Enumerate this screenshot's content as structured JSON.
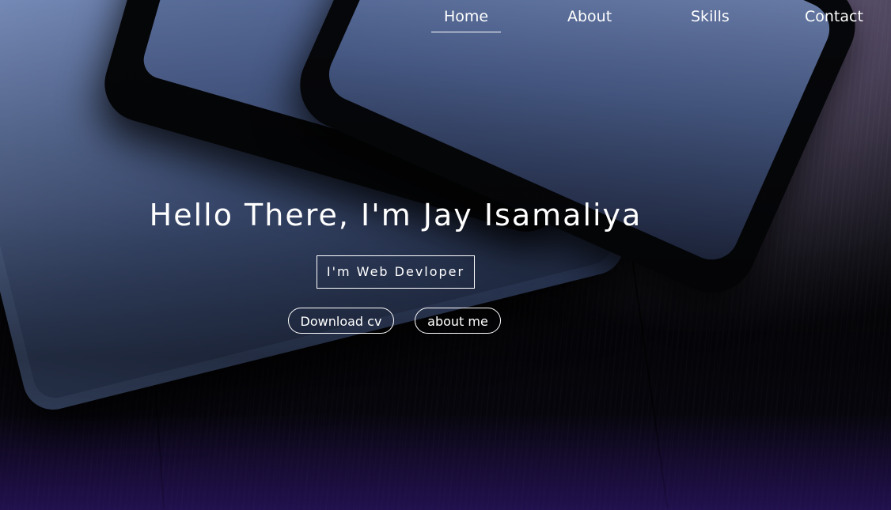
{
  "nav": {
    "items": [
      {
        "label": "Home",
        "active": true
      },
      {
        "label": "About",
        "active": false
      },
      {
        "label": "Skills",
        "active": false
      },
      {
        "label": "Contact",
        "active": false
      }
    ]
  },
  "hero": {
    "headline": "Hello There, I'm Jay Isamaliya",
    "role": "I'm Web Devloper",
    "buttons": {
      "download_cv": "Download cv",
      "about_me": "about me"
    }
  },
  "colors": {
    "text": "#ffffff",
    "accent_orange": "#be5c14",
    "accent_purple": "#2d166e"
  },
  "background": {
    "description_icon": "desk-devices-photo"
  }
}
